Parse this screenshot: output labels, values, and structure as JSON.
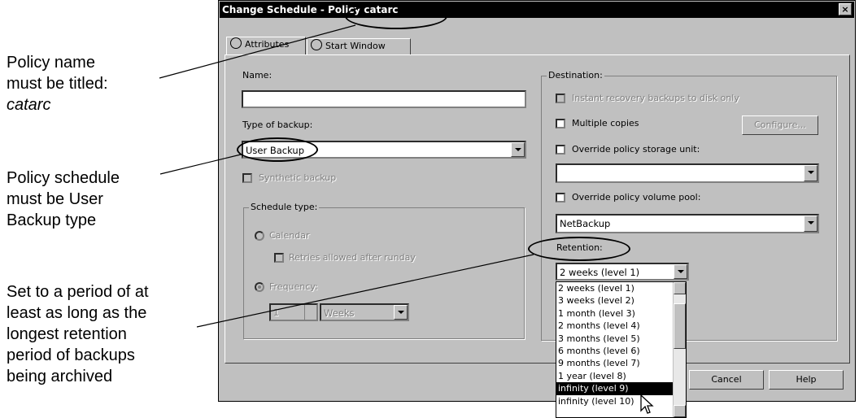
{
  "callouts": {
    "policy_name": [
      "Policy name",
      "must be titled:",
      "catarc"
    ],
    "policy_schedule": [
      "Policy schedule",
      "must be User",
      "Backup type"
    ],
    "set_period": [
      "Set to a period of at",
      "least as long as the",
      "longest retention",
      "period of backups",
      "being archived"
    ]
  },
  "dialog": {
    "title": "Change Schedule - Policy catarc",
    "close_glyph": "×",
    "tabs": [
      "Attributes",
      "Start Window"
    ],
    "name_label": "Name:",
    "name_value": "",
    "type_label": "Type of backup:",
    "type_value": "User Backup",
    "synthetic_label": "Synthetic backup",
    "schedule_type_label": "Schedule type:",
    "calendar_label": "Calendar",
    "retries_label": "Retries allowed after runday",
    "frequency_label": "Frequency:",
    "frequency_value": "1",
    "frequency_unit": "Weeks",
    "destination_label": "Destination:",
    "instant_recovery_label": "Instant recovery backups to disk only",
    "multiple_copies_label": "Multiple copies",
    "configure_label": "Configure...",
    "override_storage_label": "Override policy storage unit:",
    "override_storage_value": "",
    "override_volume_label": "Override policy volume pool:",
    "volume_pool_value": "NetBackup",
    "retention_label": "Retention:",
    "retention_value": "2 weeks (level 1)",
    "retention_options": [
      "2 weeks (level 1)",
      "3 weeks (level 2)",
      "1 month (level 3)",
      "2 months (level 4)",
      "3 months (level 5)",
      "6 months (level 6)",
      "9 months (level 7)",
      "1 year (level 8)",
      "infinity (level 9)",
      "infinity (level 10)"
    ],
    "selected_option": "infinity (level 9)",
    "cancel_label": "Cancel",
    "help_label": "Help"
  }
}
